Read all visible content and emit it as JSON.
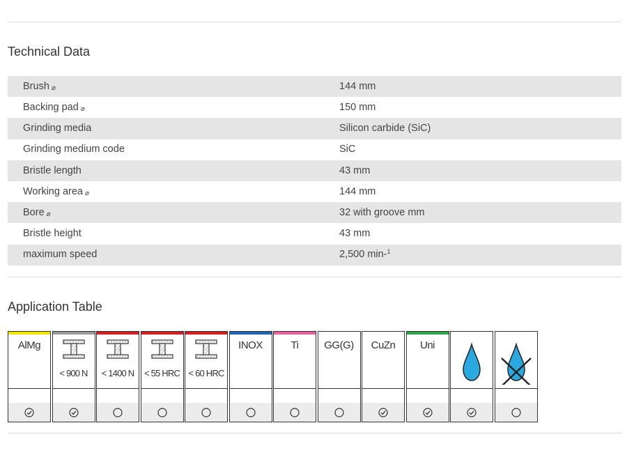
{
  "technical_data": {
    "heading": "Technical Data",
    "rows": [
      {
        "label": "Brush",
        "diameter": true,
        "value": "144 mm"
      },
      {
        "label": "Backing pad",
        "diameter": true,
        "value": "150 mm"
      },
      {
        "label": "Grinding media",
        "diameter": false,
        "value": "Silicon carbide (SiC)"
      },
      {
        "label": "Grinding medium code",
        "diameter": false,
        "value": "SiC"
      },
      {
        "label": "Bristle length",
        "diameter": false,
        "value": "43 mm"
      },
      {
        "label": "Working area",
        "diameter": true,
        "value": "144 mm"
      },
      {
        "label": "Bore",
        "diameter": true,
        "value": "32 with groove mm"
      },
      {
        "label": "Bristle height",
        "diameter": false,
        "value": "43 mm"
      },
      {
        "label": "maximum speed",
        "diameter": false,
        "value": "2,500 min-",
        "sup": "1"
      }
    ],
    "diameter_symbol": "⌀"
  },
  "application_table": {
    "heading": "Application Table",
    "columns": [
      {
        "label": "AlMg",
        "sub": "",
        "icon": "",
        "bar_color": "#f2e600",
        "suitable": true
      },
      {
        "label": "",
        "sub": "< 900 N",
        "icon": "steel-beam-icon",
        "bar_color": "#9a9a9a",
        "suitable": true
      },
      {
        "label": "",
        "sub": "< 1400 N",
        "icon": "steel-beam-icon",
        "bar_color": "#d21f26",
        "suitable": false
      },
      {
        "label": "",
        "sub": "< 55 HRC",
        "icon": "steel-beam-icon",
        "bar_color": "#d21f26",
        "suitable": false
      },
      {
        "label": "",
        "sub": "< 60 HRC",
        "icon": "steel-beam-icon",
        "bar_color": "#d21f26",
        "suitable": false
      },
      {
        "label": "INOX",
        "sub": "",
        "icon": "",
        "bar_color": "#1e64b0",
        "suitable": false
      },
      {
        "label": "Ti",
        "sub": "",
        "icon": "",
        "bar_color": "#e8609e",
        "suitable": false
      },
      {
        "label": "GG(G)",
        "sub": "",
        "icon": "",
        "bar_color": "",
        "suitable": false
      },
      {
        "label": "CuZn",
        "sub": "",
        "icon": "",
        "bar_color": "",
        "suitable": true
      },
      {
        "label": "Uni",
        "sub": "",
        "icon": "",
        "bar_color": "#2ca54b",
        "suitable": true
      },
      {
        "label": "",
        "sub": "",
        "icon": "water-drop-icon",
        "bar_color": "",
        "suitable": true
      },
      {
        "label": "",
        "sub": "",
        "icon": "dry-crossed-drop-icon",
        "bar_color": "",
        "suitable": false
      }
    ]
  },
  "colors": {
    "row_alt": "#e5e5e5",
    "drop": "#29a9df"
  }
}
